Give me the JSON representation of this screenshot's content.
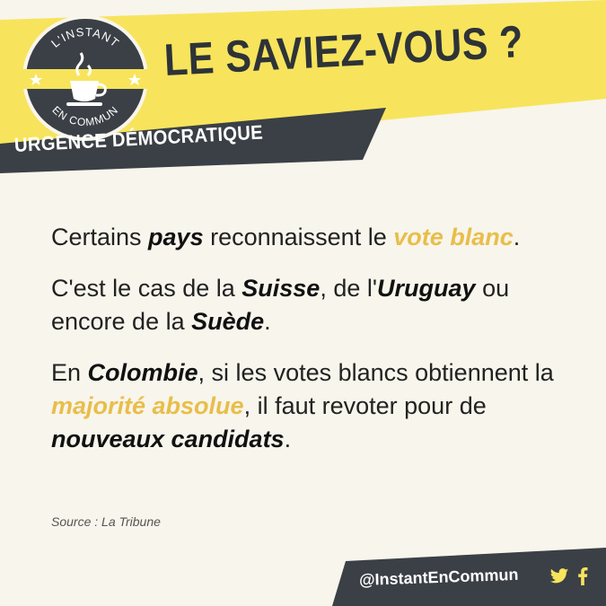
{
  "header": {
    "logo_top_text": "L'INSTANT",
    "logo_bottom_text": "EN COMMUN",
    "title": "LE SAVIEZ-VOUS ?",
    "subtitle": "URGENCE DÉMOCRATIQUE"
  },
  "body": {
    "p1": {
      "t1": "Certains ",
      "t2": "pays",
      "t3": " reconnaissent le ",
      "t4": "vote blanc",
      "t5": "."
    },
    "p2": {
      "t1": "C'est le cas de la ",
      "t2": "Suisse",
      "t3": ", de l'",
      "t4": "Uruguay",
      "t5": " ou encore de la ",
      "t6": "Suède",
      "t7": "."
    },
    "p3": {
      "t1": "En ",
      "t2": "Colombie",
      "t3": ", si les votes blancs obtiennent la ",
      "t4": "majorité absolue",
      "t5": ", il faut revoter pour de ",
      "t6": "nouveaux candidats",
      "t7": "."
    }
  },
  "source": "Source : La Tribune",
  "footer": {
    "handle": "@InstantEnCommun",
    "icons": [
      "twitter-icon",
      "facebook-icon"
    ]
  },
  "colors": {
    "yellow": "#f7e45c",
    "dark": "#3b4046",
    "accent": "#e8be4a",
    "background": "#f8f5ec"
  }
}
